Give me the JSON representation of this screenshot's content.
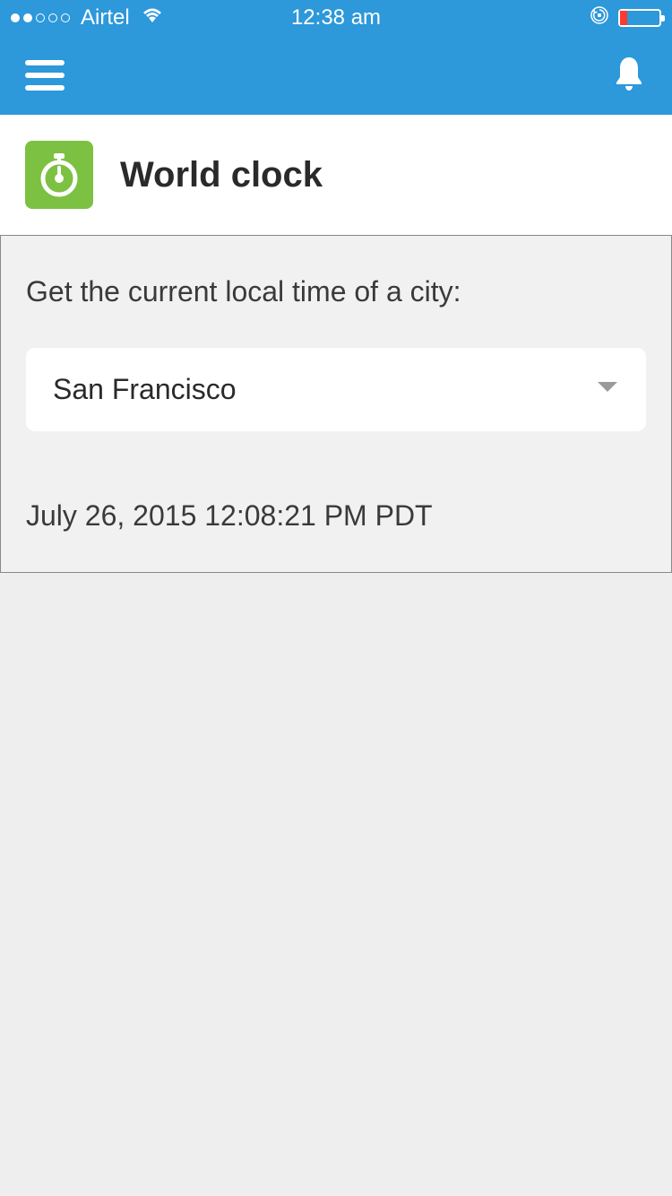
{
  "status_bar": {
    "carrier": "Airtel",
    "time": "12:38 am",
    "signal_filled": 2,
    "signal_total": 5
  },
  "nav": {
    "menu_icon": "hamburger-icon",
    "bell_icon": "bell-icon"
  },
  "header": {
    "title": "World clock",
    "icon": "stopwatch-icon"
  },
  "card": {
    "prompt": "Get the current local time of a city:",
    "dropdown": {
      "selected": "San Francisco"
    },
    "result": "July 26, 2015 12:08:21 PM PDT"
  },
  "colors": {
    "primary": "#2d98da",
    "accent_green": "#7cc142",
    "battery_low": "#ff3b30"
  }
}
